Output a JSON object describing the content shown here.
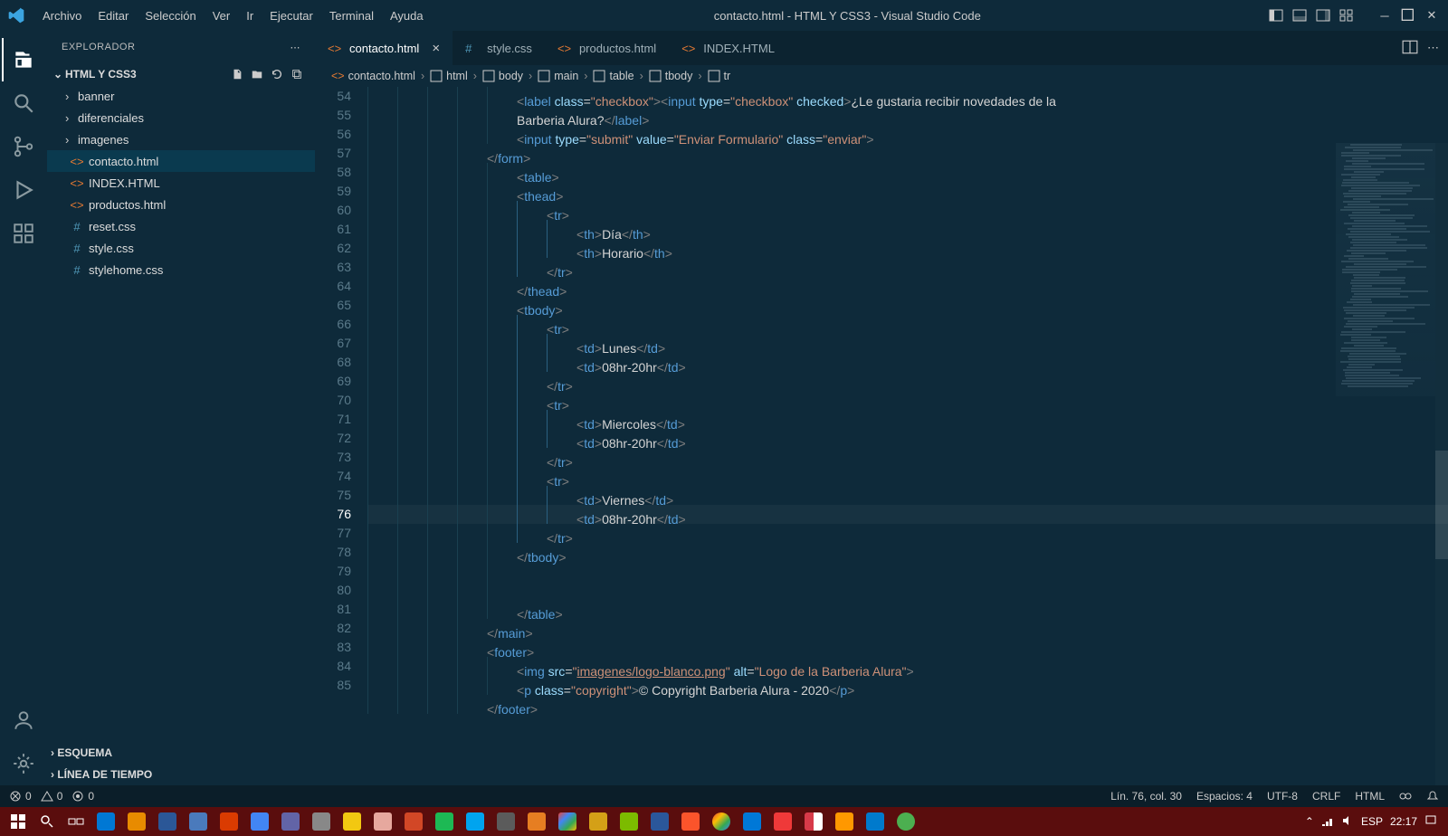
{
  "menu": [
    "Archivo",
    "Editar",
    "Selección",
    "Ver",
    "Ir",
    "Ejecutar",
    "Terminal",
    "Ayuda"
  ],
  "window_title": "contacto.html - HTML Y CSS3 - Visual Studio Code",
  "explorer": {
    "title": "EXPLORADOR",
    "section": "HTML Y CSS3",
    "folders": [
      "banner",
      "diferenciales",
      "imagenes"
    ],
    "files": [
      {
        "name": "contacto.html",
        "type": "html",
        "selected": true
      },
      {
        "name": "INDEX.HTML",
        "type": "html"
      },
      {
        "name": "productos.html",
        "type": "html"
      },
      {
        "name": "reset.css",
        "type": "css"
      },
      {
        "name": "style.css",
        "type": "css"
      },
      {
        "name": "stylehome.css",
        "type": "css"
      }
    ],
    "bottom_sections": [
      "ESQUEMA",
      "LÍNEA DE TIEMPO"
    ]
  },
  "tabs": [
    {
      "name": "contacto.html",
      "type": "html",
      "active": true
    },
    {
      "name": "style.css",
      "type": "css"
    },
    {
      "name": "productos.html",
      "type": "html"
    },
    {
      "name": "INDEX.HTML",
      "type": "html"
    }
  ],
  "breadcrumb": [
    "contacto.html",
    "html",
    "body",
    "main",
    "table",
    "tbody",
    "tr"
  ],
  "gutter": {
    "start": 54,
    "end": 85,
    "current": 76
  },
  "code": {
    "label_class": "\"checkbox\"",
    "input_type": "\"checkbox\"",
    "checked": "checked",
    "label_text_a": "¿Le gustaria recibir novedades de la",
    "label_text_b": "Barberia Alura?",
    "submit_type": "\"submit\"",
    "submit_value": "\"Enviar Formulario\"",
    "submit_class": "\"enviar\"",
    "th_dia": "Día",
    "th_horario": "Horario",
    "td_lunes": "Lunes",
    "td_horario": "08hr-20hr",
    "td_miercoles": "Miercoles",
    "td_viernes": "Viernes",
    "img_src": "\"imagenes/logo-blanco.png\"",
    "img_alt": "\"Logo de la Barberia Alura\"",
    "p_class": "\"copyright\"",
    "p_text": "&copy Copyright Barberia Alura - 2020"
  },
  "status": {
    "errors": "0",
    "warnings": "0",
    "ports": "0",
    "position": "Lín. 76, col. 30",
    "spaces": "Espacios: 4",
    "encoding": "UTF-8",
    "eol": "CRLF",
    "lang": "HTML"
  },
  "taskbar": {
    "lang": "ESP",
    "time": "22:17"
  }
}
